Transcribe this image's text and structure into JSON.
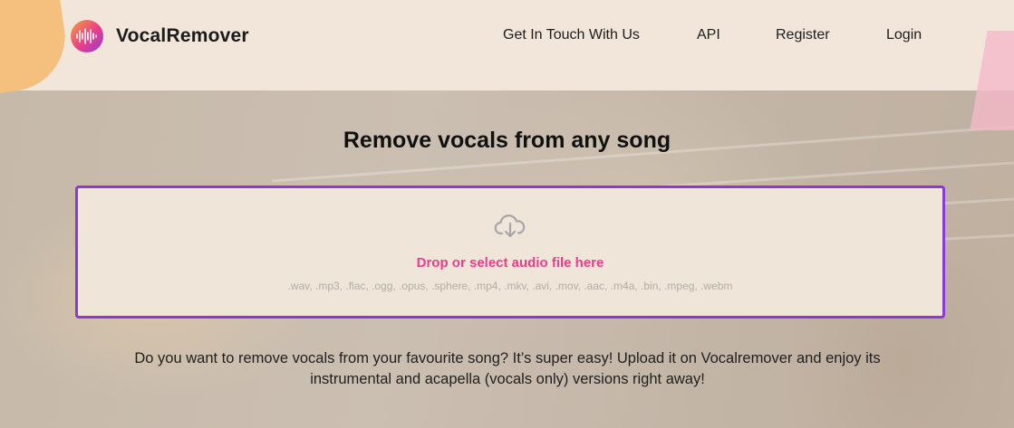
{
  "header": {
    "brand": "VocalRemover",
    "nav": [
      "Get In Touch With Us",
      "API",
      "Register",
      "Login"
    ]
  },
  "main": {
    "title": "Remove vocals from any song",
    "dropzone": {
      "label": "Drop or select audio file here",
      "formats": ".wav, .mp3, .flac, .ogg, .opus, .sphere, .mp4, .mkv, .avi, .mov, .aac, .m4a, .bin, .mpeg, .webm",
      "icon": "cloud-download-icon"
    },
    "description_line1": "Do you want to remove vocals from your favourite song? It’s super easy! Upload it on Vocalremover and enjoy its",
    "description_line2": "instrumental and acapella (vocals only) versions right away!"
  },
  "colors": {
    "accent_border": "#8a3ad6",
    "accent_text": "#e83e8c",
    "header_bg": "#f1e6d9"
  }
}
